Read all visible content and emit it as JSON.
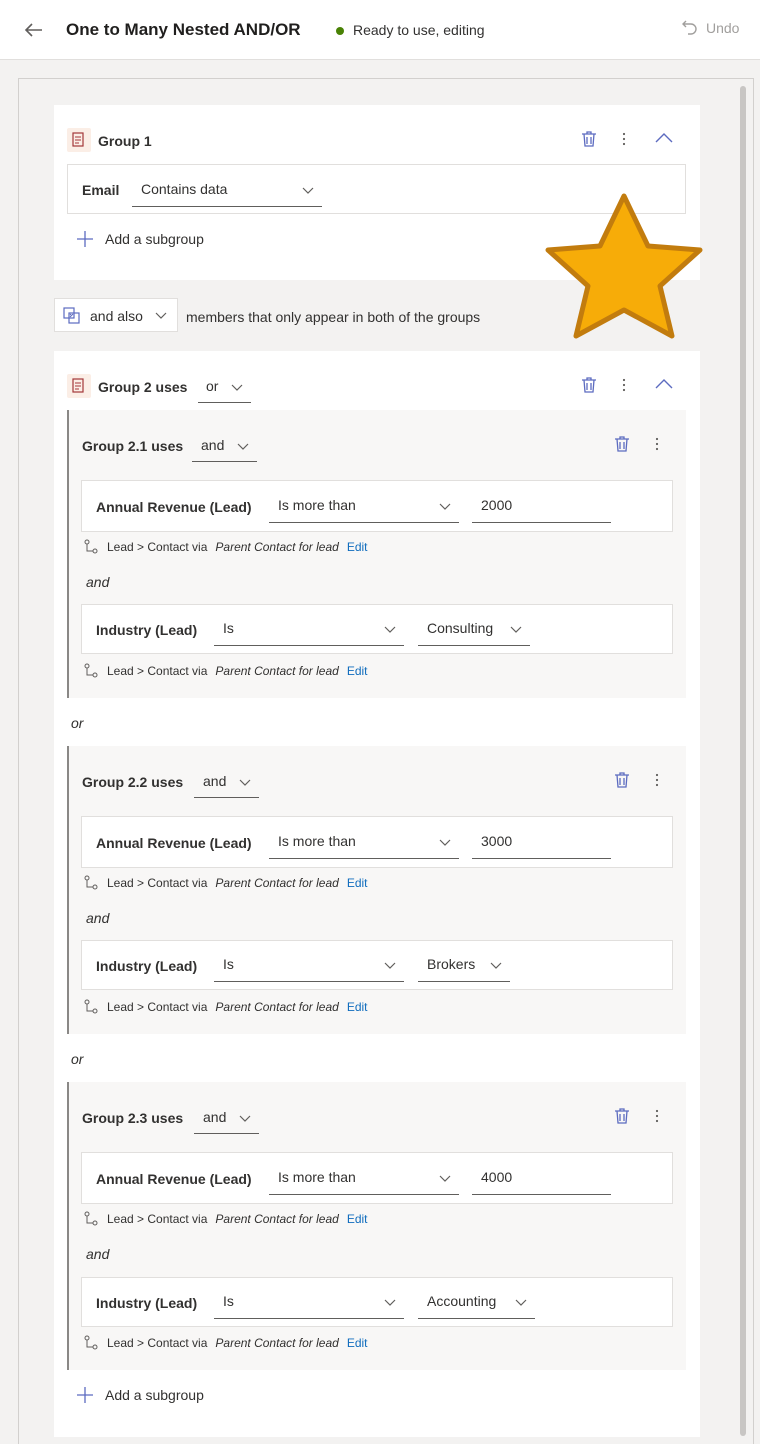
{
  "header": {
    "title": "One to Many Nested AND/OR",
    "status": "Ready to use, editing",
    "undo_label": "Undo"
  },
  "colors": {
    "status_dot": "#498205",
    "edit_link": "#0f6cbd",
    "star": "#f7ac08"
  },
  "group1": {
    "title": "Group 1",
    "condition": {
      "attribute": "Email",
      "operator": "Contains data"
    },
    "add_subgroup": "Add a subgroup"
  },
  "connector": {
    "value": "and also",
    "description": "members that only appear in both of the groups"
  },
  "group2": {
    "title": "Group 2 uses",
    "operator": "or",
    "subgroup_joiner": "or",
    "add_subgroup": "Add a subgroup",
    "subgroups": [
      {
        "title": "Group 2.1 uses",
        "operator": "and",
        "cond1": {
          "attribute": "Annual Revenue (Lead)",
          "operator": "Is more than",
          "value": "2000"
        },
        "path1": {
          "rel": "Lead > Contact via",
          "via": "Parent Contact for lead",
          "edit": "Edit"
        },
        "joiner": "and",
        "cond2": {
          "attribute": "Industry (Lead)",
          "operator": "Is",
          "value": "Consulting"
        },
        "path2": {
          "rel": "Lead > Contact via",
          "via": "Parent Contact for lead",
          "edit": "Edit"
        }
      },
      {
        "title": "Group 2.2 uses",
        "operator": "and",
        "cond1": {
          "attribute": "Annual Revenue (Lead)",
          "operator": "Is more than",
          "value": "3000"
        },
        "path1": {
          "rel": "Lead > Contact via",
          "via": "Parent Contact for lead",
          "edit": "Edit"
        },
        "joiner": "and",
        "cond2": {
          "attribute": "Industry (Lead)",
          "operator": "Is",
          "value": "Brokers"
        },
        "path2": {
          "rel": "Lead > Contact via",
          "via": "Parent Contact for lead",
          "edit": "Edit"
        }
      },
      {
        "title": "Group 2.3 uses",
        "operator": "and",
        "cond1": {
          "attribute": "Annual Revenue (Lead)",
          "operator": "Is more than",
          "value": "4000"
        },
        "path1": {
          "rel": "Lead > Contact via",
          "via": "Parent Contact for lead",
          "edit": "Edit"
        },
        "joiner": "and",
        "cond2": {
          "attribute": "Industry (Lead)",
          "operator": "Is",
          "value": "Accounting"
        },
        "path2": {
          "rel": "Lead > Contact via",
          "via": "Parent Contact for lead",
          "edit": "Edit"
        }
      }
    ]
  }
}
